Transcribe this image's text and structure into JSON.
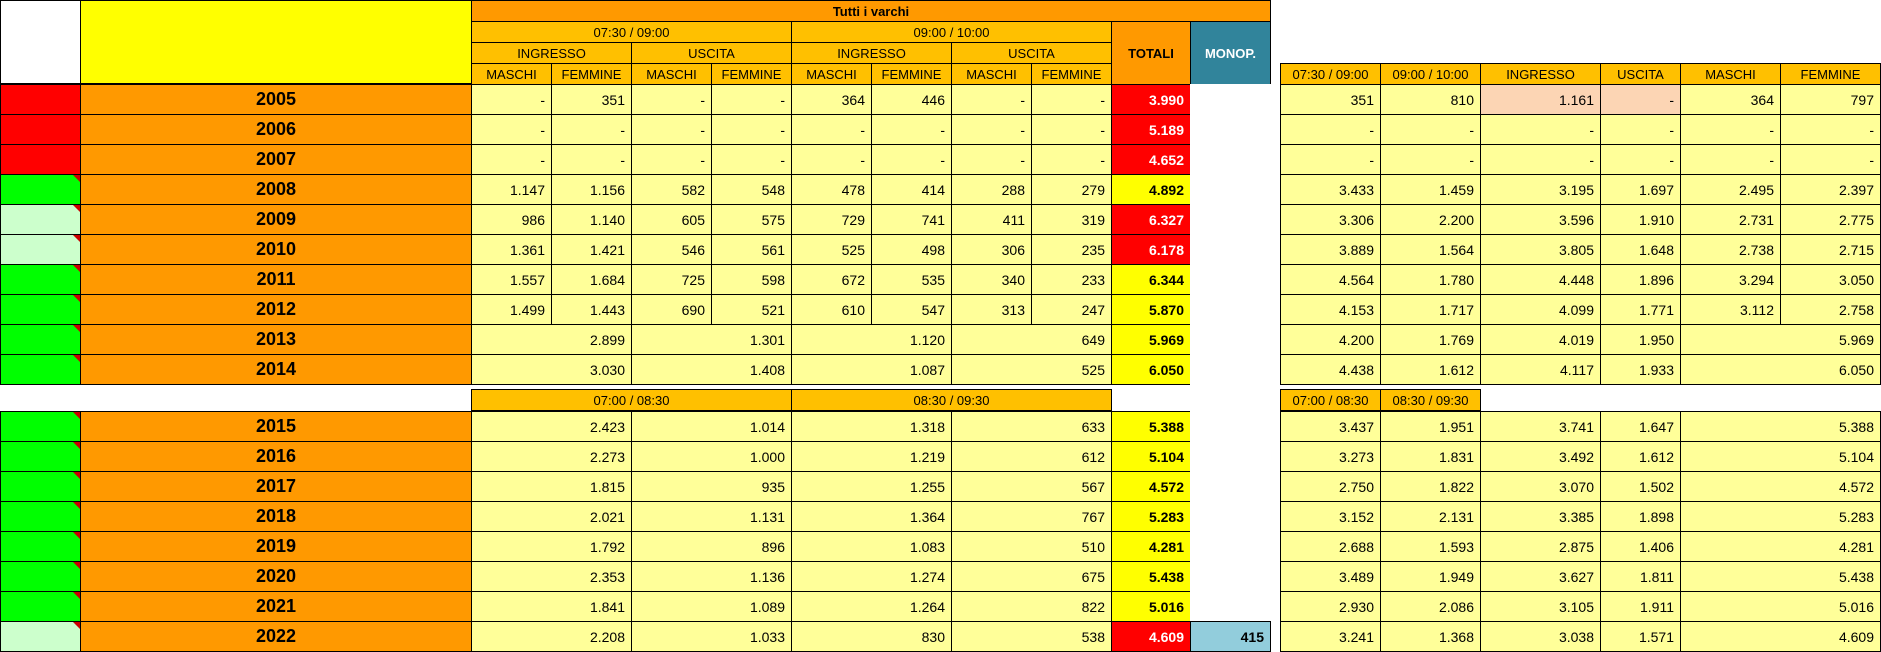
{
  "header": {
    "title": "Tutti i varchi",
    "period_a": "07:30 / 09:00",
    "period_b": "09:00 / 10:00",
    "ingresso": "INGRESSO",
    "uscita": "USCITA",
    "maschi": "MASCHI",
    "femmine": "FEMMINE",
    "totali": "TOTALI",
    "monop": "MONOP.",
    "period_c": "07:00 / 08:30",
    "period_d": "08:30 / 09:30"
  },
  "right_headers": [
    "07:30 / 09:00",
    "09:00 / 10:00",
    "INGRESSO",
    "USCITA",
    "MASCHI",
    "FEMMINE"
  ],
  "right_headers_2": [
    "07:00 / 08:30",
    "08:30 / 09:30"
  ],
  "rows_a": [
    {
      "year": "2005",
      "status": "red",
      "vals": [
        "-",
        "351",
        "-",
        "-",
        "364",
        "446",
        "-",
        "-"
      ],
      "tot": "3.990",
      "tc": "red",
      "right": [
        "351",
        "810",
        "1.161",
        "-",
        "364",
        "797"
      ]
    },
    {
      "year": "2006",
      "status": "red",
      "vals": [
        "-",
        "-",
        "-",
        "-",
        "-",
        "-",
        "-",
        "-"
      ],
      "tot": "5.189",
      "tc": "red",
      "right": [
        "-",
        "-",
        "-",
        "-",
        "-",
        "-"
      ]
    },
    {
      "year": "2007",
      "status": "red",
      "vals": [
        "-",
        "-",
        "-",
        "-",
        "-",
        "-",
        "-",
        "-"
      ],
      "tot": "4.652",
      "tc": "red",
      "right": [
        "-",
        "-",
        "-",
        "-",
        "-",
        "-"
      ]
    },
    {
      "year": "2008",
      "status": "green",
      "vals": [
        "1.147",
        "1.156",
        "582",
        "548",
        "478",
        "414",
        "288",
        "279"
      ],
      "tot": "4.892",
      "tc": "yel",
      "right": [
        "3.433",
        "1.459",
        "3.195",
        "1.697",
        "2.495",
        "2.397"
      ]
    },
    {
      "year": "2009",
      "status": "pale",
      "vals": [
        "986",
        "1.140",
        "605",
        "575",
        "729",
        "741",
        "411",
        "319"
      ],
      "tot": "6.327",
      "tc": "red",
      "right": [
        "3.306",
        "2.200",
        "3.596",
        "1.910",
        "2.731",
        "2.775"
      ]
    },
    {
      "year": "2010",
      "status": "pale",
      "vals": [
        "1.361",
        "1.421",
        "546",
        "561",
        "525",
        "498",
        "306",
        "235"
      ],
      "tot": "6.178",
      "tc": "red",
      "right": [
        "3.889",
        "1.564",
        "3.805",
        "1.648",
        "2.738",
        "2.715"
      ]
    },
    {
      "year": "2011",
      "status": "green",
      "vals": [
        "1.557",
        "1.684",
        "725",
        "598",
        "672",
        "535",
        "340",
        "233"
      ],
      "tot": "6.344",
      "tc": "yel",
      "right": [
        "4.564",
        "1.780",
        "4.448",
        "1.896",
        "3.294",
        "3.050"
      ]
    },
    {
      "year": "2012",
      "status": "green",
      "vals": [
        "1.499",
        "1.443",
        "690",
        "521",
        "610",
        "547",
        "313",
        "247"
      ],
      "tot": "5.870",
      "tc": "yel",
      "right": [
        "4.153",
        "1.717",
        "4.099",
        "1.771",
        "3.112",
        "2.758"
      ]
    }
  ],
  "rows_b": [
    {
      "year": "2013",
      "status": "green",
      "vals": [
        "2.899",
        "1.301",
        "1.120",
        "649"
      ],
      "tot": "5.969",
      "tc": "yel",
      "right": [
        "4.200",
        "1.769",
        "4.019",
        "1.950",
        "5.969"
      ]
    },
    {
      "year": "2014",
      "status": "green",
      "vals": [
        "3.030",
        "1.408",
        "1.087",
        "525"
      ],
      "tot": "6.050",
      "tc": "yel",
      "right": [
        "4.438",
        "1.612",
        "4.117",
        "1.933",
        "6.050"
      ]
    }
  ],
  "rows_c": [
    {
      "year": "2015",
      "status": "green",
      "vals": [
        "2.423",
        "1.014",
        "1.318",
        "633"
      ],
      "tot": "5.388",
      "tc": "yel",
      "monop": "",
      "right": [
        "3.437",
        "1.951",
        "3.741",
        "1.647",
        "5.388"
      ]
    },
    {
      "year": "2016",
      "status": "green",
      "vals": [
        "2.273",
        "1.000",
        "1.219",
        "612"
      ],
      "tot": "5.104",
      "tc": "yel",
      "monop": "",
      "right": [
        "3.273",
        "1.831",
        "3.492",
        "1.612",
        "5.104"
      ]
    },
    {
      "year": "2017",
      "status": "green",
      "vals": [
        "1.815",
        "935",
        "1.255",
        "567"
      ],
      "tot": "4.572",
      "tc": "yel",
      "monop": "",
      "right": [
        "2.750",
        "1.822",
        "3.070",
        "1.502",
        "4.572"
      ]
    },
    {
      "year": "2018",
      "status": "green",
      "vals": [
        "2.021",
        "1.131",
        "1.364",
        "767"
      ],
      "tot": "5.283",
      "tc": "yel",
      "monop": "",
      "right": [
        "3.152",
        "2.131",
        "3.385",
        "1.898",
        "5.283"
      ]
    },
    {
      "year": "2019",
      "status": "green",
      "vals": [
        "1.792",
        "896",
        "1.083",
        "510"
      ],
      "tot": "4.281",
      "tc": "yel",
      "monop": "",
      "right": [
        "2.688",
        "1.593",
        "2.875",
        "1.406",
        "4.281"
      ]
    },
    {
      "year": "2020",
      "status": "green",
      "vals": [
        "2.353",
        "1.136",
        "1.274",
        "675"
      ],
      "tot": "5.438",
      "tc": "yel",
      "monop": "",
      "right": [
        "3.489",
        "1.949",
        "3.627",
        "1.811",
        "5.438"
      ]
    },
    {
      "year": "2021",
      "status": "green",
      "vals": [
        "1.841",
        "1.089",
        "1.264",
        "822"
      ],
      "tot": "5.016",
      "tc": "yel",
      "monop": "",
      "right": [
        "2.930",
        "2.086",
        "3.105",
        "1.911",
        "5.016"
      ]
    },
    {
      "year": "2022",
      "status": "pale",
      "vals": [
        "2.208",
        "1.033",
        "830",
        "538"
      ],
      "tot": "4.609",
      "tc": "red",
      "monop": "415",
      "right": [
        "3.241",
        "1.368",
        "3.038",
        "1.571",
        "4.609"
      ]
    }
  ],
  "colors": {
    "status_red": "#ff0000",
    "status_green": "#00ff00",
    "status_pale": "#ccffcc",
    "year_bg": "#ff9900",
    "header_bg": "#ffc000",
    "cell_bg": "#ffff99",
    "monop_bg": "#31849b"
  }
}
